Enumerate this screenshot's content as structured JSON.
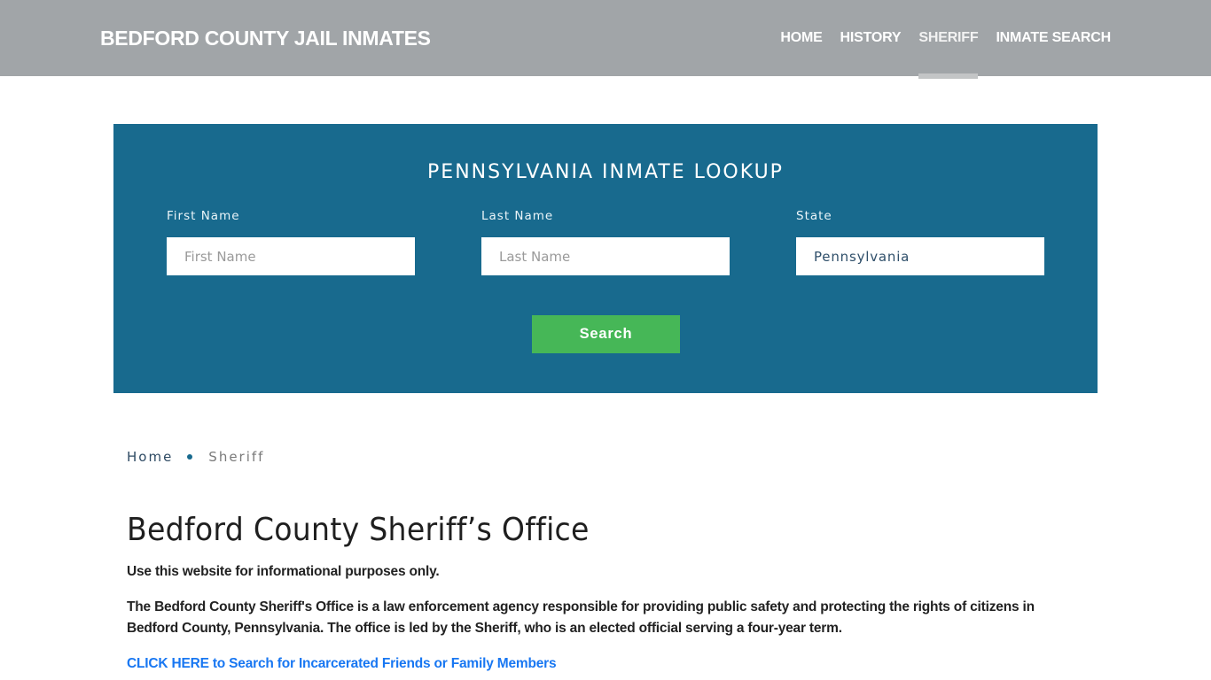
{
  "header": {
    "brand": "BEDFORD COUNTY JAIL INMATES",
    "nav": [
      {
        "label": "HOME",
        "active": false
      },
      {
        "label": "HISTORY",
        "active": false
      },
      {
        "label": "SHERIFF",
        "active": true
      },
      {
        "label": "INMATE SEARCH",
        "active": false
      }
    ]
  },
  "lookup": {
    "title": "PENNSYLVANIA INMATE LOOKUP",
    "fields": [
      {
        "label": "First Name",
        "placeholder": "First Name",
        "value": ""
      },
      {
        "label": "Last Name",
        "placeholder": "Last Name",
        "value": ""
      },
      {
        "label": "State",
        "placeholder": "",
        "value": "Pennsylvania"
      }
    ],
    "search_label": "Search",
    "colors": {
      "panel": "#186a8e",
      "button": "#46b757"
    }
  },
  "breadcrumb": {
    "home": "Home",
    "current": "Sheriff"
  },
  "content": {
    "title": "Bedford County Sheriff’s Office",
    "paragraphs": [
      "Use this website for informational purposes only.",
      "The Bedford County Sheriff's Office is a law enforcement agency responsible for providing public safety and protecting the rights of citizens in Bedford County, Pennsylvania. The office is led by the Sheriff, who is an elected official serving a four-year term."
    ],
    "cta_link": "CLICK HERE to Search for Incarcerated Friends or Family Members",
    "link_color": "#1877f2"
  }
}
